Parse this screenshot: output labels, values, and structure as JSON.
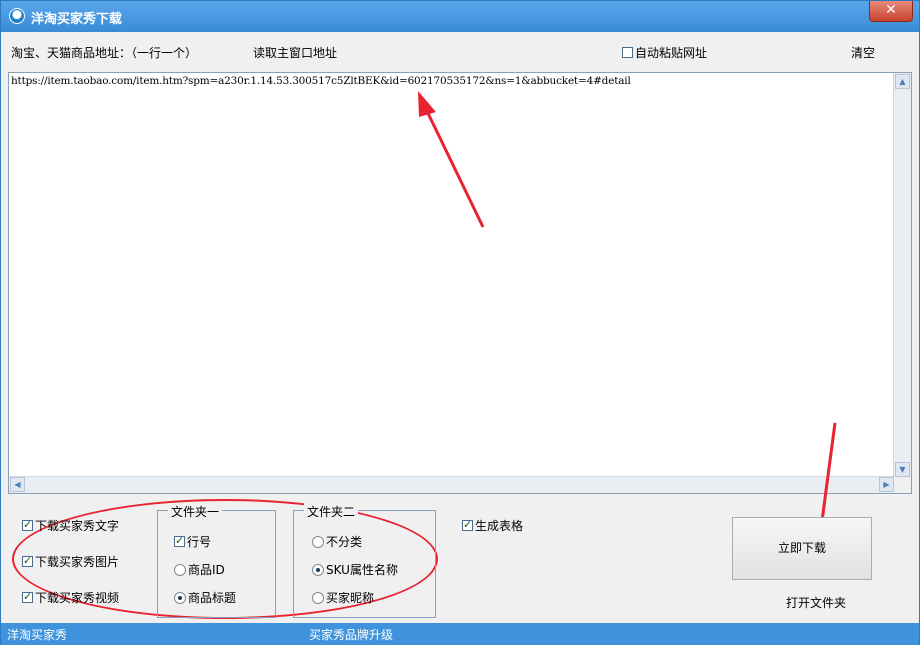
{
  "window": {
    "title": "洋淘买家秀下载",
    "close_label": "✕"
  },
  "toolbar": {
    "address_label": "淘宝、天猫商品地址：（一行一个）",
    "read_main_label": "读取主窗口地址",
    "auto_paste_label": "自动粘贴网址",
    "auto_paste_checked": false,
    "clear_label": "清空"
  },
  "editor": {
    "url_text": "https://item.taobao.com/item.htm?spm=a230r.1.14.53.300517c5ZltBEK&id=602170535172&ns=1&abbucket=4#detail"
  },
  "options": {
    "download_text": {
      "label": "下载买家秀文字",
      "checked": true
    },
    "download_images": {
      "label": "下载买家秀图片",
      "checked": true
    },
    "download_video": {
      "label": "下载买家秀视频",
      "checked": true
    },
    "generate_table": {
      "label": "生成表格",
      "checked": true
    }
  },
  "folder1": {
    "legend": "文件夹一",
    "items": [
      {
        "label": "行号",
        "kind": "checkbox",
        "checked": true
      },
      {
        "label": "商品ID",
        "kind": "radio",
        "checked": false
      },
      {
        "label": "商品标题",
        "kind": "radio",
        "checked": true
      }
    ]
  },
  "folder2": {
    "legend": "文件夹二",
    "items": [
      {
        "label": "不分类",
        "kind": "radio",
        "checked": false
      },
      {
        "label": "SKU属性名称",
        "kind": "radio",
        "checked": true
      },
      {
        "label": "买家昵称",
        "kind": "radio",
        "checked": false
      }
    ]
  },
  "actions": {
    "download_now": "立即下载",
    "open_folder": "打开文件夹"
  },
  "status": {
    "left": "洋淘买家秀",
    "center": "买家秀品牌升级"
  },
  "colors": {
    "titlebar": "#3a8bd6",
    "statusbar": "#3f93dc",
    "annotation": "#e8222e"
  }
}
